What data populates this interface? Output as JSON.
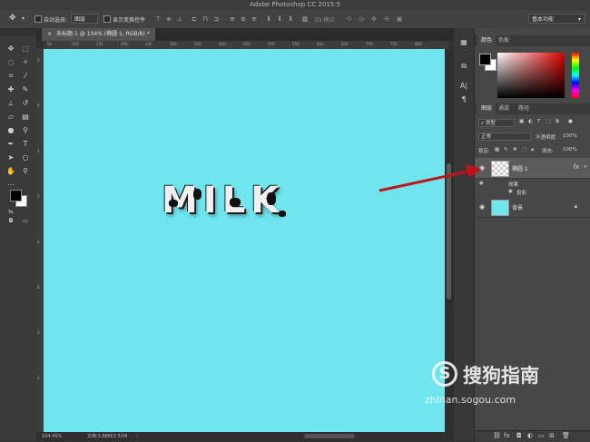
{
  "window": {
    "title": "Adobe Photoshop CC 2015.5"
  },
  "options_bar": {
    "auto_select_label": "自动选择:",
    "auto_select_value": "图层",
    "show_transform_label": "显示变换控件",
    "mode_3d_label": "3D 模式:",
    "workspace_value": "基本功能"
  },
  "document": {
    "tab_label": "未标题-1 @ 104% (椭圆 1, RGB/8) *",
    "ruler_ticks": [
      "50",
      "100",
      "150",
      "200",
      "250",
      "300",
      "350",
      "400",
      "450",
      "500",
      "550",
      "600",
      "650",
      "700",
      "750",
      "800"
    ],
    "canvas_text": "MILK",
    "canvas_color": "#6fe5ee"
  },
  "status": {
    "zoom": "104.45%",
    "doc_size": "文档:1.88M/2.51M"
  },
  "color_panel": {
    "tabs": [
      "颜色",
      "色板"
    ]
  },
  "layers_panel": {
    "tabs": [
      "图层",
      "通道",
      "路径"
    ],
    "filter_kind": "类型",
    "blend_mode": "正常",
    "opacity_label": "不透明度:",
    "opacity_value": "100%",
    "lock_label": "锁定:",
    "fill_label": "填充:",
    "fill_value": "100%",
    "layers": [
      {
        "name": "椭圆 1",
        "selected": true,
        "fx": "fx",
        "effects_label": "效果",
        "effects": [
          "投影"
        ]
      },
      {
        "name": "背景",
        "selected": false
      }
    ]
  },
  "watermark": {
    "brand": "搜狗指南",
    "url": "zhinan.sogou.com"
  },
  "colors": {
    "arrow": "#c0141a",
    "panel_bg": "#474747",
    "canvas_bg": "#6fe5ee"
  }
}
